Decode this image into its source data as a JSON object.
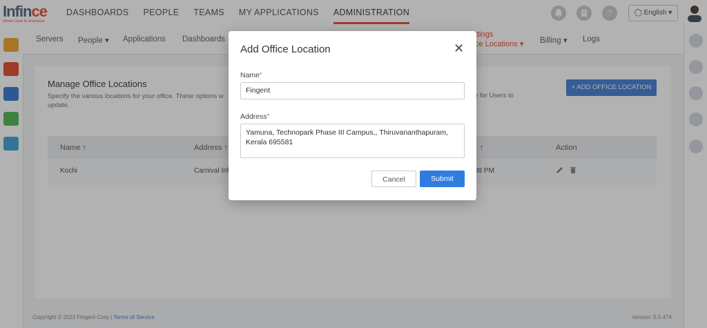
{
  "logo": {
    "main_a": "Inf",
    "main_b": "in",
    "main_c": "ce",
    "sub": "Infinite Cloud for Enterprise"
  },
  "topnav": [
    "DASHBOARDS",
    "PEOPLE",
    "TEAMS",
    "MY APPLICATIONS",
    "ADMINISTRATION"
  ],
  "topnav_active": "ADMINISTRATION",
  "header_icons": [
    "bell-icon",
    "notepad-icon",
    "help-icon"
  ],
  "help_glyph": "?",
  "language": "English",
  "subnav": {
    "servers": "Servers",
    "people": "People",
    "applications": "Applications",
    "dashboards": "Dashboards",
    "settings": "ttings",
    "office_locations": "ce Locations",
    "billing": "Billing",
    "logs": "Logs"
  },
  "page": {
    "title": "Manage Office Locations",
    "description": "Specify the various locations for your office. These options w",
    "description_line2": "update.",
    "description_right": "e for Users to",
    "add_button": "+ ADD OFFICE LOCATION"
  },
  "table": {
    "headers": [
      "Name ↑",
      "Address ↑",
      "↑",
      "Action"
    ],
    "rows": [
      {
        "name": "Kochi",
        "address": "Carnival Inf",
        "time": "08 PM"
      }
    ]
  },
  "footer": {
    "copyright": "Copyright © 2023 Fingent Corp | ",
    "terms": "Terms of Service",
    "version": "Version: 5.0.474"
  },
  "modal": {
    "title": "Add Office Location",
    "close": "✕",
    "name_label": "Name",
    "name_value": "Fingent",
    "address_label": "Address",
    "address_value": "Yamuna, Technopark Phase III Campus,, Thiruvananthapuram, Kerala 695581",
    "required_mark": "*",
    "cancel": "Cancel",
    "submit": "Submit"
  },
  "colors": {
    "accent": "#e8543e",
    "primary": "#2f7ce0",
    "logo": "#5a6b85"
  }
}
